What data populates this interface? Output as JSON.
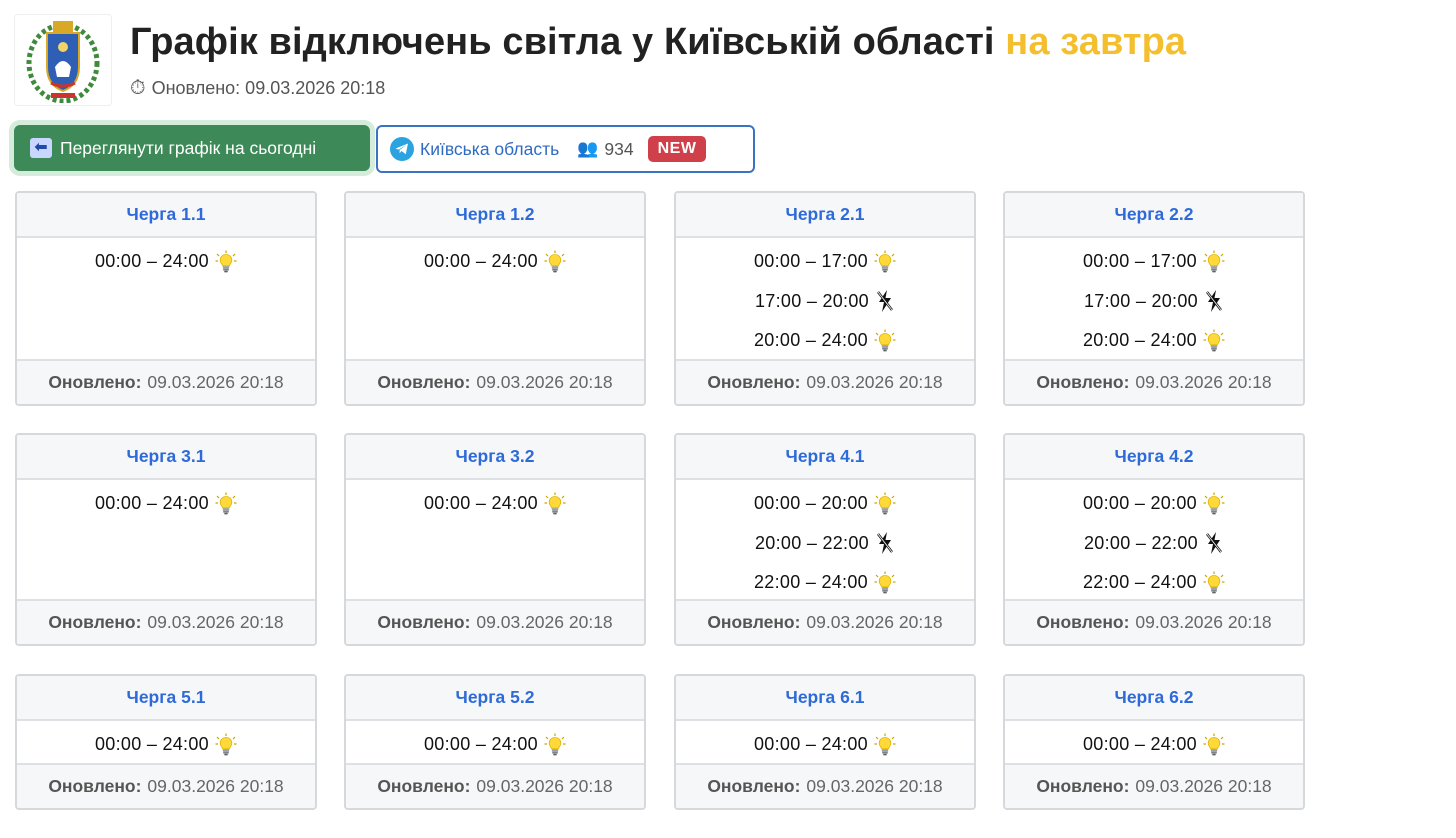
{
  "header": {
    "title_main": "Графік відключень світла у Київській області",
    "title_accent": "на завтра",
    "updated_icon": "stopwatch-icon",
    "updated_text": "Оновлено: 09.03.2026 20:18"
  },
  "toolbar": {
    "today_button_label": "Переглянути графік на сьогодні",
    "telegram_label": "Київська область",
    "members_count": "934",
    "new_badge": "NEW"
  },
  "colors": {
    "accent": "#f4bf2e",
    "button_green": "#3d8a58",
    "link_blue": "#2e6bd9",
    "badge_red": "#d0404a"
  },
  "queues": [
    {
      "name": "Черга 1.1",
      "slots": [
        {
          "time": "00:00 – 24:00",
          "status": "on"
        }
      ],
      "footer_label": "Оновлено:",
      "footer_value": "09.03.2026 20:18"
    },
    {
      "name": "Черга 1.2",
      "slots": [
        {
          "time": "00:00 – 24:00",
          "status": "on"
        }
      ],
      "footer_label": "Оновлено:",
      "footer_value": "09.03.2026 20:18"
    },
    {
      "name": "Черга 2.1",
      "slots": [
        {
          "time": "00:00 – 17:00",
          "status": "on"
        },
        {
          "time": "17:00 – 20:00",
          "status": "off"
        },
        {
          "time": "20:00 – 24:00",
          "status": "on"
        }
      ],
      "footer_label": "Оновлено:",
      "footer_value": "09.03.2026 20:18"
    },
    {
      "name": "Черга 2.2",
      "slots": [
        {
          "time": "00:00 – 17:00",
          "status": "on"
        },
        {
          "time": "17:00 – 20:00",
          "status": "off"
        },
        {
          "time": "20:00 – 24:00",
          "status": "on"
        }
      ],
      "footer_label": "Оновлено:",
      "footer_value": "09.03.2026 20:18"
    },
    {
      "name": "Черга 3.1",
      "slots": [
        {
          "time": "00:00 – 24:00",
          "status": "on"
        }
      ],
      "footer_label": "Оновлено:",
      "footer_value": "09.03.2026 20:18"
    },
    {
      "name": "Черга 3.2",
      "slots": [
        {
          "time": "00:00 – 24:00",
          "status": "on"
        }
      ],
      "footer_label": "Оновлено:",
      "footer_value": "09.03.2026 20:18"
    },
    {
      "name": "Черга 4.1",
      "slots": [
        {
          "time": "00:00 – 20:00",
          "status": "on"
        },
        {
          "time": "20:00 – 22:00",
          "status": "off"
        },
        {
          "time": "22:00 – 24:00",
          "status": "on"
        }
      ],
      "footer_label": "Оновлено:",
      "footer_value": "09.03.2026 20:18"
    },
    {
      "name": "Черга 4.2",
      "slots": [
        {
          "time": "00:00 – 20:00",
          "status": "on"
        },
        {
          "time": "20:00 – 22:00",
          "status": "off"
        },
        {
          "time": "22:00 – 24:00",
          "status": "on"
        }
      ],
      "footer_label": "Оновлено:",
      "footer_value": "09.03.2026 20:18"
    },
    {
      "name": "Черга 5.1",
      "slots": [
        {
          "time": "00:00 – 24:00",
          "status": "on"
        }
      ],
      "footer_label": "Оновлено:",
      "footer_value": "09.03.2026 20:18"
    },
    {
      "name": "Черга 5.2",
      "slots": [
        {
          "time": "00:00 – 24:00",
          "status": "on"
        }
      ],
      "footer_label": "Оновлено:",
      "footer_value": "09.03.2026 20:18"
    },
    {
      "name": "Черга 6.1",
      "slots": [
        {
          "time": "00:00 – 24:00",
          "status": "on"
        }
      ],
      "footer_label": "Оновлено:",
      "footer_value": "09.03.2026 20:18"
    },
    {
      "name": "Черга 6.2",
      "slots": [
        {
          "time": "00:00 – 24:00",
          "status": "on"
        }
      ],
      "footer_label": "Оновлено:",
      "footer_value": "09.03.2026 20:18"
    }
  ],
  "icons": {
    "on": "lightbulb-icon",
    "off": "power-off-icon"
  }
}
